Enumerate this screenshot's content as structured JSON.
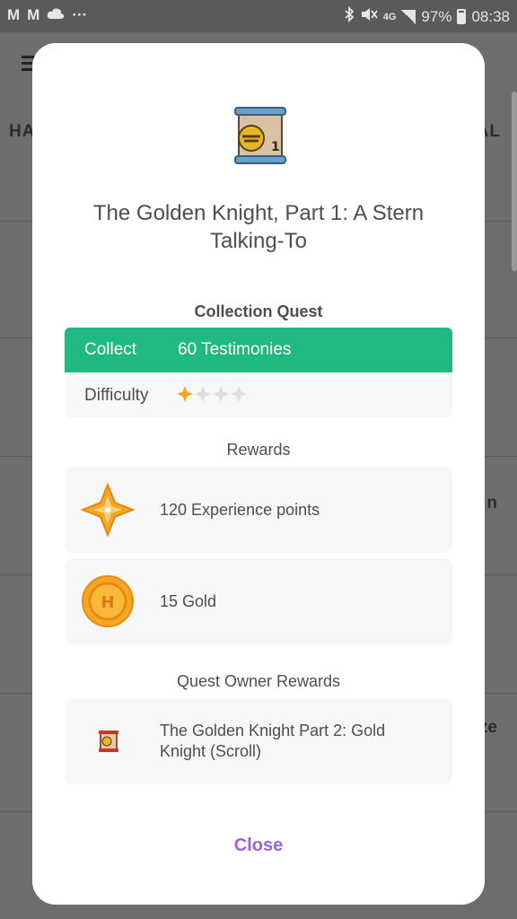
{
  "status_bar": {
    "left_icons": [
      "gmail-icon",
      "gmail-icon",
      "cloud-icon",
      "more-dots-icon"
    ],
    "network": "4G",
    "battery": "97%",
    "time": "08:38"
  },
  "background": {
    "tab_left": "HA",
    "tab_right": "AL",
    "side_text_1": "n",
    "side_text_2": "ze"
  },
  "dialog": {
    "title": "The Golden Knight, Part 1: A Stern Talking-To",
    "quest_type": "Collection Quest",
    "collect_label": "Collect",
    "collect_value": "60 Testimonies",
    "difficulty_label": "Difficulty",
    "difficulty": 1,
    "difficulty_max": 4,
    "rewards_heading": "Rewards",
    "rewards": [
      {
        "icon": "experience-star-icon",
        "text": "120 Experience points"
      },
      {
        "icon": "gold-coin-icon",
        "text": "15 Gold"
      }
    ],
    "owner_rewards_heading": "Quest Owner Rewards",
    "owner_rewards": [
      {
        "icon": "scroll-icon",
        "text": "The Golden Knight Part 2: Gold Knight (Scroll)"
      }
    ],
    "close_label": "Close"
  },
  "colors": {
    "accent_green": "#20b97f",
    "close_purple": "#9a62e0",
    "star_gold": "#f5a623"
  }
}
